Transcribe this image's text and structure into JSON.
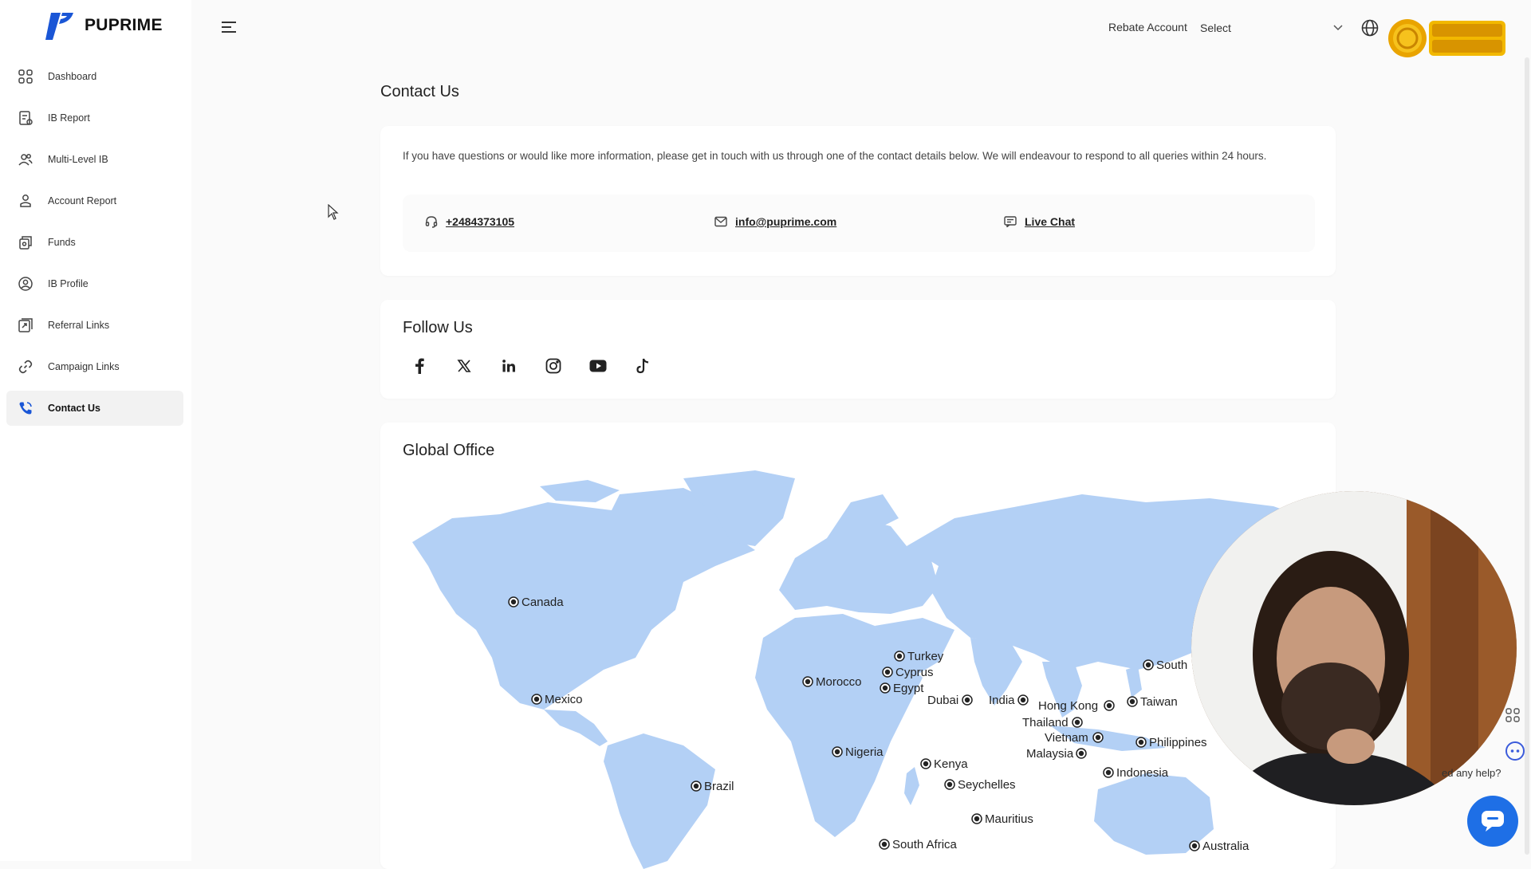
{
  "brand": {
    "name": "PUPRIME"
  },
  "sidebar": {
    "items": [
      {
        "label": "Dashboard",
        "icon": "dashboard-icon"
      },
      {
        "label": "IB Report",
        "icon": "report-icon"
      },
      {
        "label": "Multi-Level IB",
        "icon": "users-icon"
      },
      {
        "label": "Account Report",
        "icon": "user-icon"
      },
      {
        "label": "Funds",
        "icon": "funds-icon"
      },
      {
        "label": "IB Profile",
        "icon": "profile-icon"
      },
      {
        "label": "Referral Links",
        "icon": "referral-icon"
      },
      {
        "label": "Campaign Links",
        "icon": "link-icon"
      },
      {
        "label": "Contact Us",
        "icon": "phone-icon",
        "active": true
      }
    ]
  },
  "header": {
    "rebate_label": "Rebate Account",
    "select_value": "Select"
  },
  "main": {
    "title": "Contact Us",
    "intro": "If you have questions or would like more information, please get in touch with us through one of the contact details below. We will endeavour to respond to all queries within 24 hours.",
    "phone": "+2484373105",
    "email": "info@puprime.com",
    "live_chat": "Live Chat",
    "follow_title": "Follow Us",
    "socials": [
      "facebook-icon",
      "x-icon",
      "linkedin-icon",
      "instagram-icon",
      "youtube-icon",
      "tiktok-icon"
    ],
    "global_title": "Global Office",
    "offices": [
      "Canada",
      "Mexico",
      "Brazil",
      "Morocco",
      "Nigeria",
      "Turkey",
      "Cyprus",
      "Egypt",
      "Dubai",
      "India",
      "Kenya",
      "Seychelles",
      "Mauritius",
      "South Africa",
      "Hong Kong",
      "Thailand",
      "Vietnam",
      "Malaysia",
      "Indonesia",
      "Taiwan",
      "Philippines",
      "South",
      "Australia"
    ]
  },
  "help_widget": {
    "text": "ed any help?"
  },
  "colors": {
    "map_land": "#b3d0f5",
    "accent": "#1e6fe6",
    "brand": "#1a56d6"
  }
}
